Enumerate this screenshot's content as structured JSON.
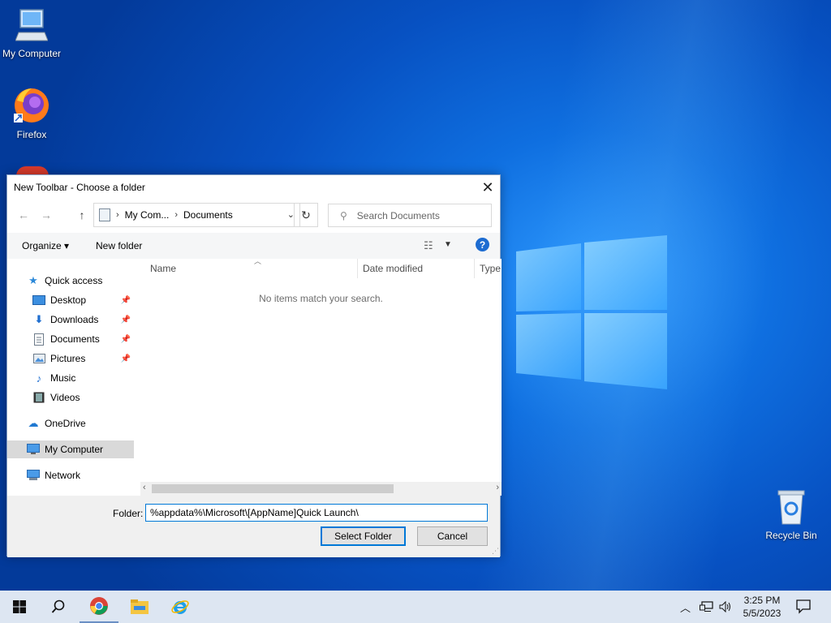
{
  "desktop": {
    "icons": [
      {
        "name": "my-computer",
        "label": "My Computer",
        "icon": "computer-icon"
      },
      {
        "name": "firefox",
        "label": "Firefox",
        "icon": "firefox-icon"
      },
      {
        "name": "recycle-bin",
        "label": "Recycle Bin",
        "icon": "recycle-bin-icon"
      }
    ]
  },
  "dialog": {
    "title": "New Toolbar - Choose a folder",
    "address": {
      "crumbs": [
        "My Com...",
        "Documents"
      ]
    },
    "search": {
      "placeholder": "Search Documents"
    },
    "commands": {
      "organize": "Organize ▾",
      "new_folder": "New folder"
    },
    "nav": {
      "quick_access": "Quick access",
      "items": [
        {
          "label": "Desktop",
          "pinned": true
        },
        {
          "label": "Downloads",
          "pinned": true
        },
        {
          "label": "Documents",
          "pinned": true
        },
        {
          "label": "Pictures",
          "pinned": true
        },
        {
          "label": "Music",
          "pinned": false
        },
        {
          "label": "Videos",
          "pinned": false
        }
      ],
      "onedrive": "OneDrive",
      "my_computer": "My Computer",
      "network": "Network"
    },
    "columns": [
      "Name",
      "Date modified",
      "Type"
    ],
    "empty_message": "No items match your search.",
    "folder_label": "Folder:",
    "folder_value": "%appdata%\\Microsoft\\[AppName]Quick Launch\\",
    "select_button": "Select Folder",
    "cancel_button": "Cancel"
  },
  "taskbar": {
    "clock_time": "3:25 PM",
    "clock_date": "5/5/2023",
    "colors": {
      "accent": "#0078d7",
      "taskbar": "#dde6f2"
    }
  }
}
